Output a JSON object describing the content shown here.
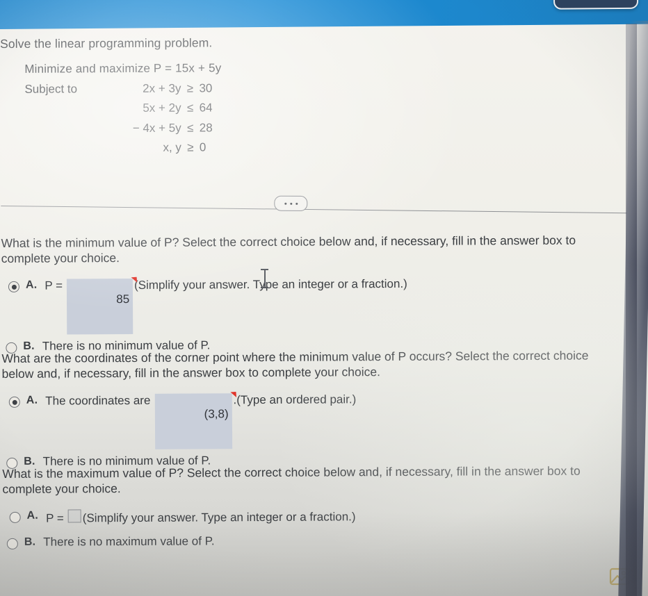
{
  "header": {
    "pill_label": ""
  },
  "problem": {
    "title": "Solve the linear programming problem.",
    "objective_label": "Minimize and maximize",
    "objective_expr": "P = 15x + 5y",
    "subject_label": "Subject to",
    "constraints": [
      {
        "expr": "2x + 3y",
        "rel": "≥",
        "rhs": "30"
      },
      {
        "expr": "5x + 2y",
        "rel": "≤",
        "rhs": "64"
      },
      {
        "expr": "− 4x + 5y",
        "rel": "≤",
        "rhs": "28"
      },
      {
        "expr": "x, y",
        "rel": "≥",
        "rhs": "0"
      }
    ]
  },
  "divider": {
    "more_label": "more-options"
  },
  "sections": [
    {
      "id": "minimum-value",
      "question": "What is the minimum value of P? Select the correct choice below and, if necessary, fill in the answer box to complete your choice.",
      "choices": [
        {
          "letter": "A.",
          "selected": true,
          "prefix": "P =",
          "answer_value": "85",
          "answer_filled": true,
          "flagged": true,
          "hint": "(Simplify your answer. Type an integer or a fraction.)"
        },
        {
          "letter": "B.",
          "selected": false,
          "prefix": "",
          "answer_value": "",
          "answer_filled": false,
          "flagged": false,
          "text": "There is no minimum value of P."
        }
      ]
    },
    {
      "id": "corner-point-coordinates",
      "question": "What are the coordinates of the corner point where the minimum value of P occurs? Select the correct choice below and, if necessary, fill in the answer box to complete your choice.",
      "choices": [
        {
          "letter": "A.",
          "selected": true,
          "prefix": "The coordinates are",
          "answer_value": "(3,8)",
          "answer_filled": true,
          "flagged": true,
          "suffix": ".",
          "hint": "(Type an ordered pair.)"
        },
        {
          "letter": "B.",
          "selected": false,
          "prefix": "",
          "answer_value": "",
          "answer_filled": false,
          "flagged": false,
          "text": "There is no minimum value of P."
        }
      ]
    },
    {
      "id": "maximum-value",
      "question": "What is the maximum value of P? Select the correct choice below and, if necessary, fill in the answer box to complete your choice.",
      "choices": [
        {
          "letter": "A.",
          "selected": false,
          "prefix": "P =",
          "answer_value": "",
          "answer_filled": false,
          "flagged": false,
          "hint": "(Simplify your answer. Type an integer or a fraction.)"
        },
        {
          "letter": "B.",
          "selected": false,
          "prefix": "",
          "answer_value": "",
          "answer_filled": false,
          "flagged": false,
          "text": "There is no maximum value of P."
        }
      ]
    }
  ],
  "colors": {
    "header_blue": "#1a8bd6",
    "answer_box_fill": "#c9cfda",
    "flag_red": "#e0342a",
    "icon_gold": "#b9a25a",
    "text": "#3a3d41"
  },
  "footer": {
    "image_icon_name": "image-placeholder-icon"
  }
}
